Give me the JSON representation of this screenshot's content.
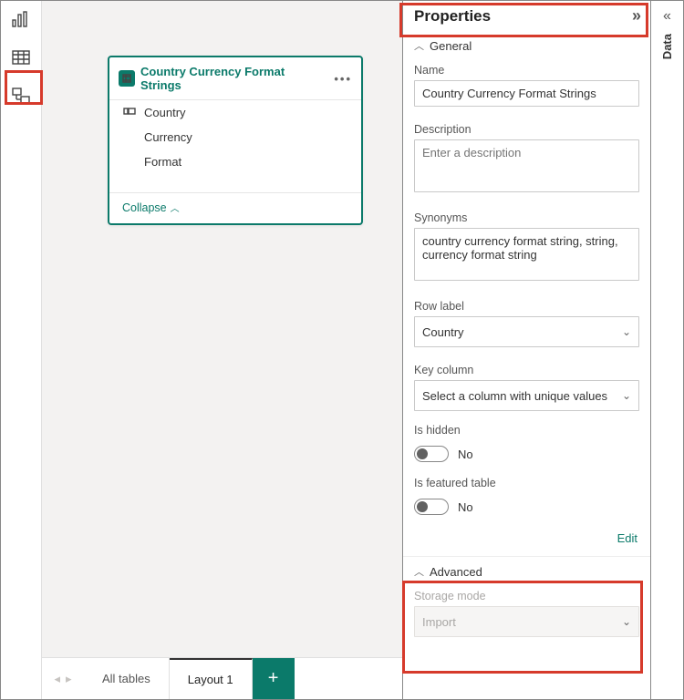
{
  "nav": {
    "tooltip_report": "Report view",
    "tooltip_table": "Table view",
    "tooltip_model": "Model view"
  },
  "card": {
    "title": "Country Currency Format Strings",
    "fields": [
      "Country",
      "Currency",
      "Format"
    ],
    "collapse_label": "Collapse"
  },
  "tabs": {
    "all": "All tables",
    "layout": "Layout 1"
  },
  "props": {
    "header": "Properties",
    "section_general": "General",
    "name_label": "Name",
    "name_value": "Country Currency Format Strings",
    "description_label": "Description",
    "description_placeholder": "Enter a description",
    "synonyms_label": "Synonyms",
    "synonyms_value": "country currency format string, string, currency format string",
    "row_label_label": "Row label",
    "row_label_value": "Country",
    "key_column_label": "Key column",
    "key_column_value": "Select a column with unique values",
    "is_hidden_label": "Is hidden",
    "is_hidden_value": "No",
    "is_featured_label": "Is featured table",
    "is_featured_value": "No",
    "edit_label": "Edit",
    "section_advanced": "Advanced",
    "storage_mode_label": "Storage mode",
    "storage_mode_value": "Import"
  },
  "rail": {
    "label": "Data"
  }
}
